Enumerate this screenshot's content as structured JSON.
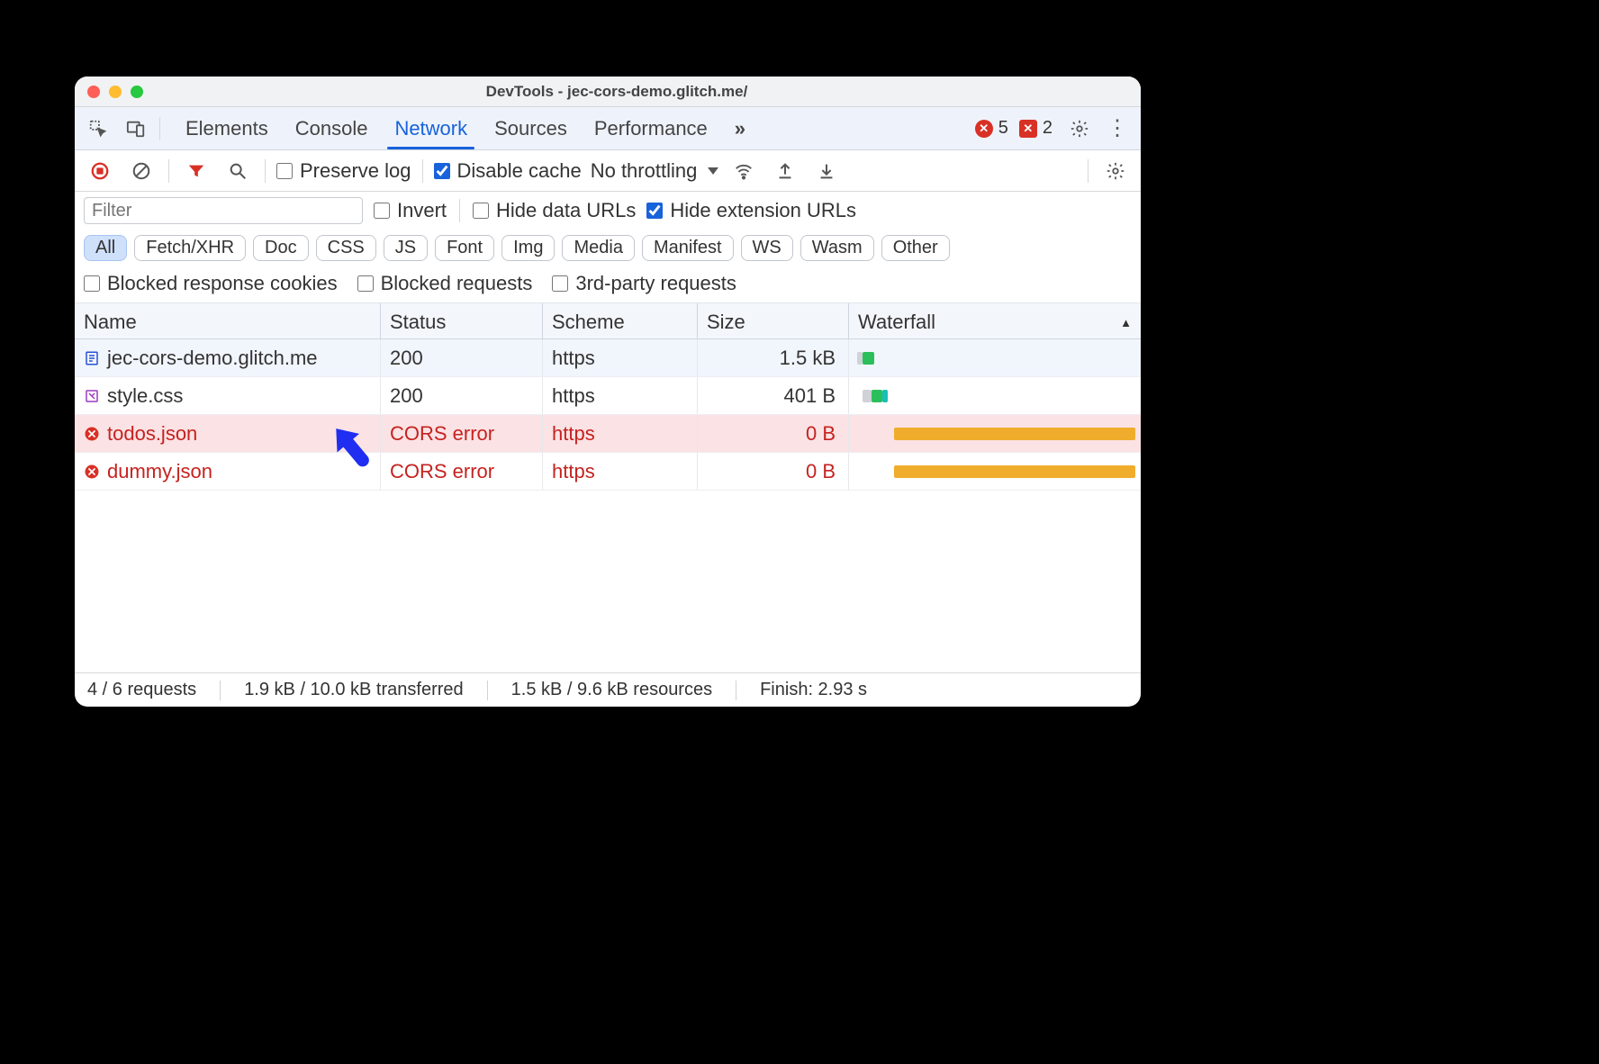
{
  "window": {
    "title": "DevTools - jec-cors-demo.glitch.me/"
  },
  "tabsbar": {
    "tabs": [
      "Elements",
      "Console",
      "Network",
      "Sources",
      "Performance"
    ],
    "active_index": 2,
    "overflow": "»",
    "error_count": "5",
    "warning_count": "2"
  },
  "toolbar": {
    "preserve_log": "Preserve log",
    "disable_cache": "Disable cache",
    "throttling": "No throttling"
  },
  "filters": {
    "placeholder": "Filter",
    "invert": "Invert",
    "hide_data_urls": "Hide data URLs",
    "hide_extension_urls": "Hide extension URLs",
    "types": [
      "All",
      "Fetch/XHR",
      "Doc",
      "CSS",
      "JS",
      "Font",
      "Img",
      "Media",
      "Manifest",
      "WS",
      "Wasm",
      "Other"
    ],
    "types_active_index": 0,
    "blocked_cookies": "Blocked response cookies",
    "blocked_requests": "Blocked requests",
    "third_party": "3rd-party requests"
  },
  "table": {
    "columns": [
      "Name",
      "Status",
      "Scheme",
      "Size",
      "Waterfall"
    ],
    "sort_indicator": "▲",
    "rows": [
      {
        "name": "jec-cors-demo.glitch.me",
        "status": "200",
        "scheme": "https",
        "size": "1.5 kB",
        "icon": "document",
        "error": false,
        "alt": true,
        "wf": {
          "start": 3,
          "width": 4,
          "color": "#2bbf5b",
          "queue": 2
        }
      },
      {
        "name": "style.css",
        "status": "200",
        "scheme": "https",
        "size": "401 B",
        "icon": "stylesheet",
        "error": false,
        "alt": false,
        "wf": {
          "start": 6,
          "width": 4,
          "color": "#2bbf5b",
          "queue": 3,
          "second": "#1bbeb3"
        }
      },
      {
        "name": "todos.json",
        "status": "CORS error",
        "scheme": "https",
        "size": "0 B",
        "icon": "error",
        "error": true,
        "highlight": true,
        "alt": false,
        "wf": {
          "start": 14,
          "width": 86,
          "color": "#f0ad2d",
          "queue": 0
        }
      },
      {
        "name": "dummy.json",
        "status": "CORS error",
        "scheme": "https",
        "size": "0 B",
        "icon": "error",
        "error": true,
        "alt": false,
        "wf": {
          "start": 14,
          "width": 86,
          "color": "#f0ad2d",
          "queue": 0
        }
      }
    ]
  },
  "statusbar": {
    "requests": "4 / 6 requests",
    "transferred": "1.9 kB / 10.0 kB transferred",
    "resources": "1.5 kB / 9.6 kB resources",
    "finish": "Finish: 2.93 s"
  }
}
